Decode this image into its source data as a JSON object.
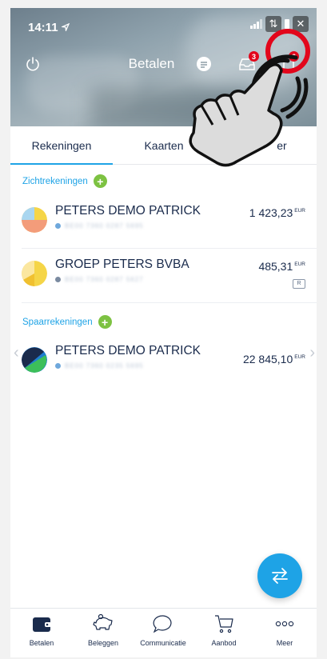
{
  "status_bar": {
    "time": "14:11",
    "location_arrow": "location-arrow-icon"
  },
  "header": {
    "title": "Betalen",
    "message_badge": "3",
    "notification_badge": "6"
  },
  "tabs": [
    {
      "label": "Rekeningen",
      "active": true
    },
    {
      "label": "Kaarten",
      "active": false
    },
    {
      "label": "er",
      "active": false
    }
  ],
  "sections": {
    "current": {
      "title": "Zichtrekeningen"
    },
    "savings": {
      "title": "Spaarrekeningen"
    }
  },
  "accounts": [
    {
      "name": "PETERS DEMO PATRICK",
      "iban": "BE00 7360 0287 5695",
      "amount": "1 423,23",
      "currency": "EUR"
    },
    {
      "name": "GROEP PETERS BVBA",
      "iban": "BE00 7360 0287 5627",
      "amount": "485,31",
      "currency": "EUR"
    },
    {
      "name": "PETERS DEMO PATRICK",
      "iban": "BE00 7360 0235 5695",
      "amount": "22 845,10",
      "currency": "EUR"
    }
  ],
  "bottom_nav": [
    {
      "label": "Betalen",
      "icon": "wallet-icon"
    },
    {
      "label": "Beleggen",
      "icon": "piggy-bank-icon"
    },
    {
      "label": "Communicatie",
      "icon": "speech-bubble-icon"
    },
    {
      "label": "Aanbod",
      "icon": "shopping-cart-icon"
    },
    {
      "label": "Meer",
      "icon": "more-dots-icon"
    }
  ],
  "colors": {
    "accent": "#1ea3e6",
    "add_green": "#7dc242",
    "badge_red": "#e2061b",
    "text_navy": "#1a2b4c"
  }
}
